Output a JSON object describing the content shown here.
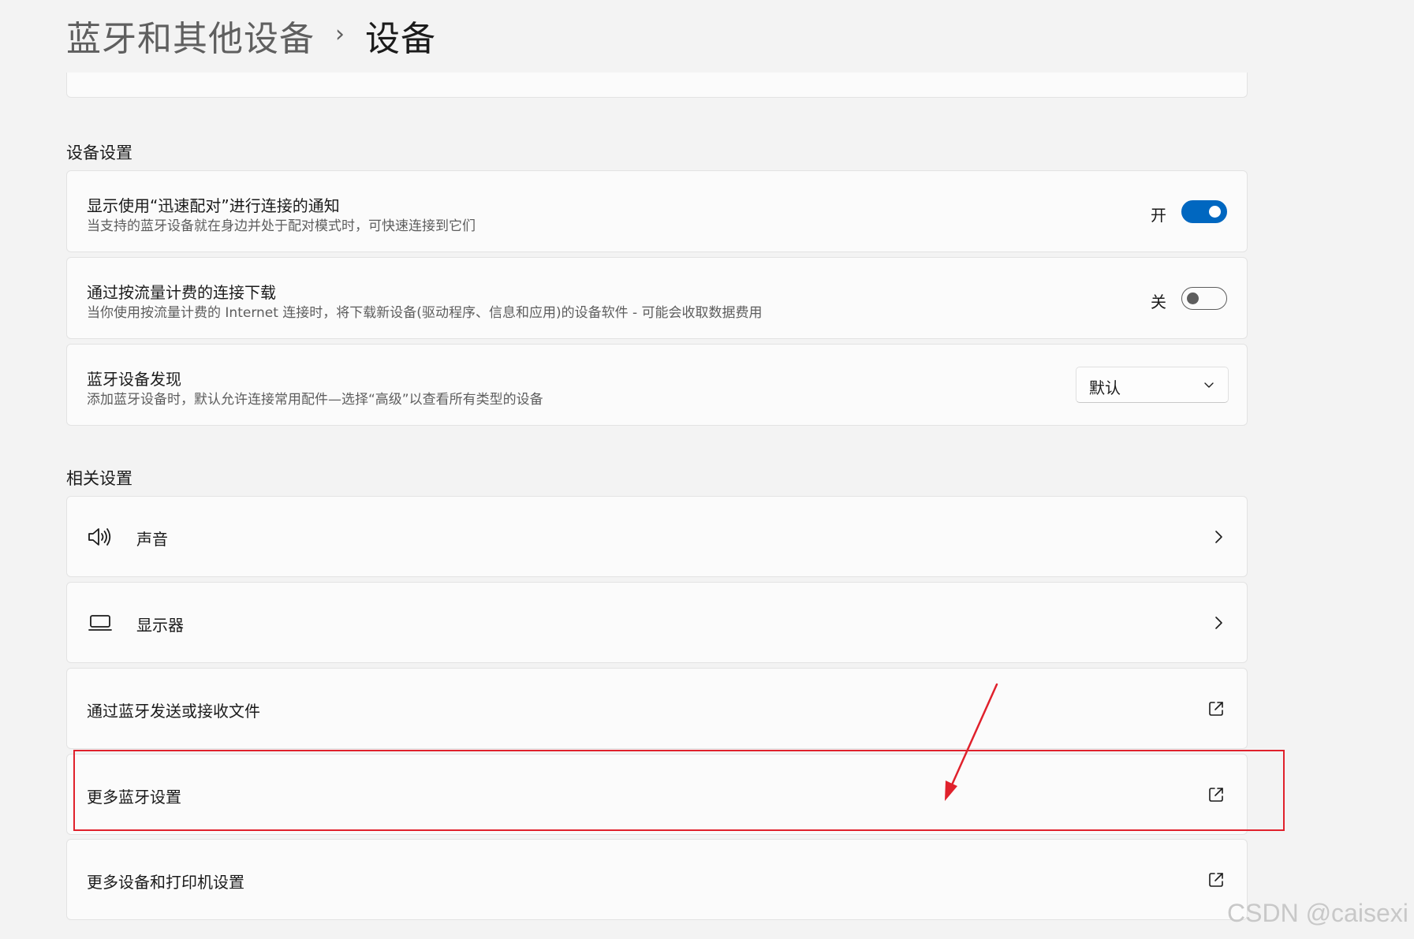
{
  "breadcrumb": {
    "parent": "蓝牙和其他设备",
    "separator": "›",
    "current": "设备"
  },
  "device_settings": {
    "heading": "设备设置",
    "swift_pair": {
      "title": "显示使用“迅速配对”进行连接的通知",
      "description": "当支持的蓝牙设备就在身边并处于配对模式时，可快速连接到它们",
      "state_label": "开",
      "enabled": true
    },
    "metered_download": {
      "title": "通过按流量计费的连接下载",
      "description": "当你使用按流量计费的 Internet 连接时，将下载新设备(驱动程序、信息和应用)的设备软件 - 可能会收取数据费用",
      "state_label": "关",
      "enabled": false
    },
    "discovery": {
      "title": "蓝牙设备发现",
      "description": "添加蓝牙设备时，默认允许连接常用配件—选择“高级”以查看所有类型的设备",
      "selected": "默认"
    }
  },
  "related_settings": {
    "heading": "相关设置",
    "items": [
      {
        "label": "声音",
        "icon": "speaker-icon",
        "action": "chevron-right-icon"
      },
      {
        "label": "显示器",
        "icon": "laptop-icon",
        "action": "chevron-right-icon"
      },
      {
        "label": "通过蓝牙发送或接收文件",
        "icon": "",
        "action": "external-link-icon"
      },
      {
        "label": "更多蓝牙设置",
        "icon": "",
        "action": "external-link-icon"
      },
      {
        "label": "更多设备和打印机设置",
        "icon": "",
        "action": "external-link-icon"
      }
    ]
  },
  "annotation": {
    "highlight_color": "#e0212c",
    "arrow_color": "#e0212c"
  },
  "colors": {
    "accent": "#0067c0",
    "background": "#f3f3f3",
    "card": "#fbfbfb"
  },
  "watermark": "CSDN @caisexi"
}
